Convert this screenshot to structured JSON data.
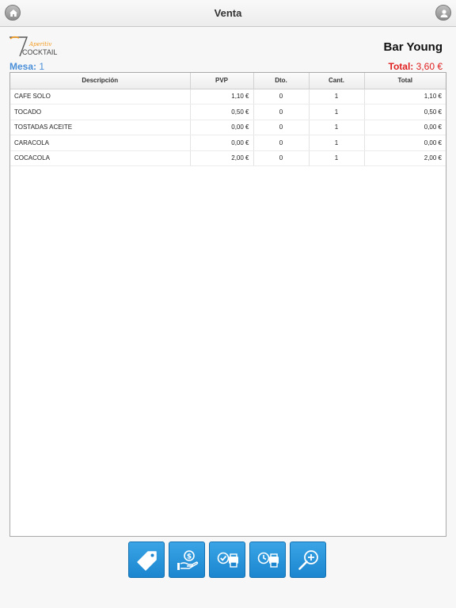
{
  "header": {
    "title": "Venta"
  },
  "logo": {
    "top": "Aperitiv",
    "bottom": "COCKTAIL"
  },
  "store": {
    "name": "Bar Young"
  },
  "mesa": {
    "label": "Mesa:",
    "value": " 1"
  },
  "total": {
    "label": "Total:",
    "value": " 3,60 €"
  },
  "table": {
    "headers": {
      "desc": "Descripción",
      "pvp": "PVP",
      "dto": "Dto.",
      "cant": "Cant.",
      "total": "Total"
    },
    "rows": [
      {
        "desc": "CAFE SOLO",
        "pvp": "1,10 €",
        "dto": "0",
        "cant": "1",
        "total": "1,10 €"
      },
      {
        "desc": "TOCADO",
        "pvp": "0,50 €",
        "dto": "0",
        "cant": "1",
        "total": "0,50 €"
      },
      {
        "desc": "TOSTADAS ACEITE",
        "pvp": "0,00 €",
        "dto": "0",
        "cant": "1",
        "total": "0,00 €"
      },
      {
        "desc": "CARACOLA",
        "pvp": "0,00 €",
        "dto": "0",
        "cant": "1",
        "total": "0,00 €"
      },
      {
        "desc": "COCACOLA",
        "pvp": "2,00 €",
        "dto": "0",
        "cant": "1",
        "total": "2,00 €"
      }
    ]
  },
  "toolbar": {
    "buttons": [
      {
        "name": "price-tag-button",
        "icon": "tag-icon"
      },
      {
        "name": "payment-button",
        "icon": "hand-coin-icon"
      },
      {
        "name": "print-check-button",
        "icon": "printer-check-icon"
      },
      {
        "name": "print-later-button",
        "icon": "printer-clock-icon"
      },
      {
        "name": "zoom-in-button",
        "icon": "zoom-in-icon"
      }
    ]
  },
  "colors": {
    "accent": "#1b86cf",
    "mesa": "#4a8fd8",
    "total": "#e02020"
  }
}
